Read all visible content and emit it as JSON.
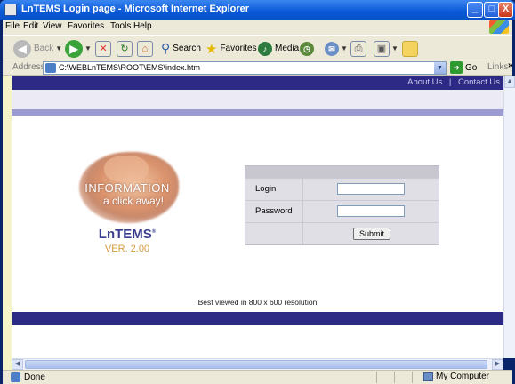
{
  "window": {
    "title": "LnTEMS Login page - Microsoft Internet Explorer",
    "buttons": {
      "minimize": "_",
      "maximize": "□",
      "close": "X"
    }
  },
  "menubar": [
    "File",
    "Edit",
    "View",
    "Favorites",
    "Tools",
    "Help"
  ],
  "toolbar": {
    "back": "Back",
    "search": "Search",
    "favorites": "Favorites",
    "media": "Media"
  },
  "addressbar": {
    "label": "Address",
    "url": "C:\\WEBLnTEMS\\ROOT\\EMS\\index.htm",
    "go": "Go",
    "links": "Links",
    "chevron": "»"
  },
  "page": {
    "top_links": {
      "about": "About Us",
      "separator": "|",
      "contact": "Contact Us"
    },
    "logo": {
      "line1": "INFORMATION",
      "line2": "a click away!",
      "brand": "LnTEMS",
      "brand_mark": "®",
      "version": "VER. 2.00"
    },
    "login_form": {
      "login_label": "Login",
      "password_label": "Password",
      "login_value": "",
      "password_value": "",
      "submit_label": "Submit"
    },
    "footnote": "Best viewed in 800 x 600 resolution"
  },
  "statusbar": {
    "status": "Done",
    "zone": "My Computer"
  },
  "colors": {
    "page_band": "#2d2a86",
    "page_midband": "#9b9bd2",
    "brand": "#3a3d8e",
    "version": "#d99a3a",
    "xp_title": "#0a58d6"
  }
}
